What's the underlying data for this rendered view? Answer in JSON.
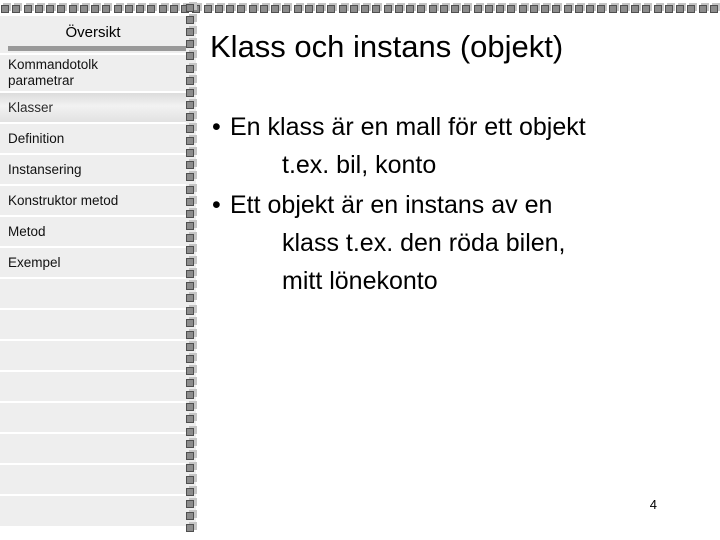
{
  "sidebar": {
    "title": "Översikt",
    "items": [
      {
        "label": "Kommandotolk\nparametrar",
        "selected": false,
        "two_line": true
      },
      {
        "label": "Klasser",
        "selected": true,
        "two_line": false
      },
      {
        "label": "Definition",
        "selected": false,
        "two_line": false
      },
      {
        "label": "Instansering",
        "selected": false,
        "two_line": false
      },
      {
        "label": "Konstruktor metod",
        "selected": false,
        "two_line": false
      },
      {
        "label": "Metod",
        "selected": false,
        "two_line": false
      },
      {
        "label": "Exempel",
        "selected": false,
        "two_line": false
      }
    ],
    "empty_row_count": 8,
    "background_color": "#eeeeee",
    "rule_color": "#999999",
    "separator_color": "#ffffff"
  },
  "slide": {
    "title": "Klass och instans (objekt)",
    "bullets": [
      {
        "marker": "•",
        "line1": "En klass är en mall för ett objekt",
        "line2": "t.ex. bil, konto"
      },
      {
        "marker": "•",
        "line1": "Ett objekt är en instans av en",
        "line2": "klass t.ex. den röda bilen,",
        "line3": "mitt lönekonto"
      }
    ],
    "page_number": "4",
    "background_color": "#ffffff",
    "text_color": "#000000"
  },
  "binding": {
    "ring_color": "#8c8c8c",
    "ring_border_color": "#4f4f4f",
    "ring_shadow_color": "#c6c6c6",
    "top_ring_count": 64,
    "left_ring_count": 44
  }
}
